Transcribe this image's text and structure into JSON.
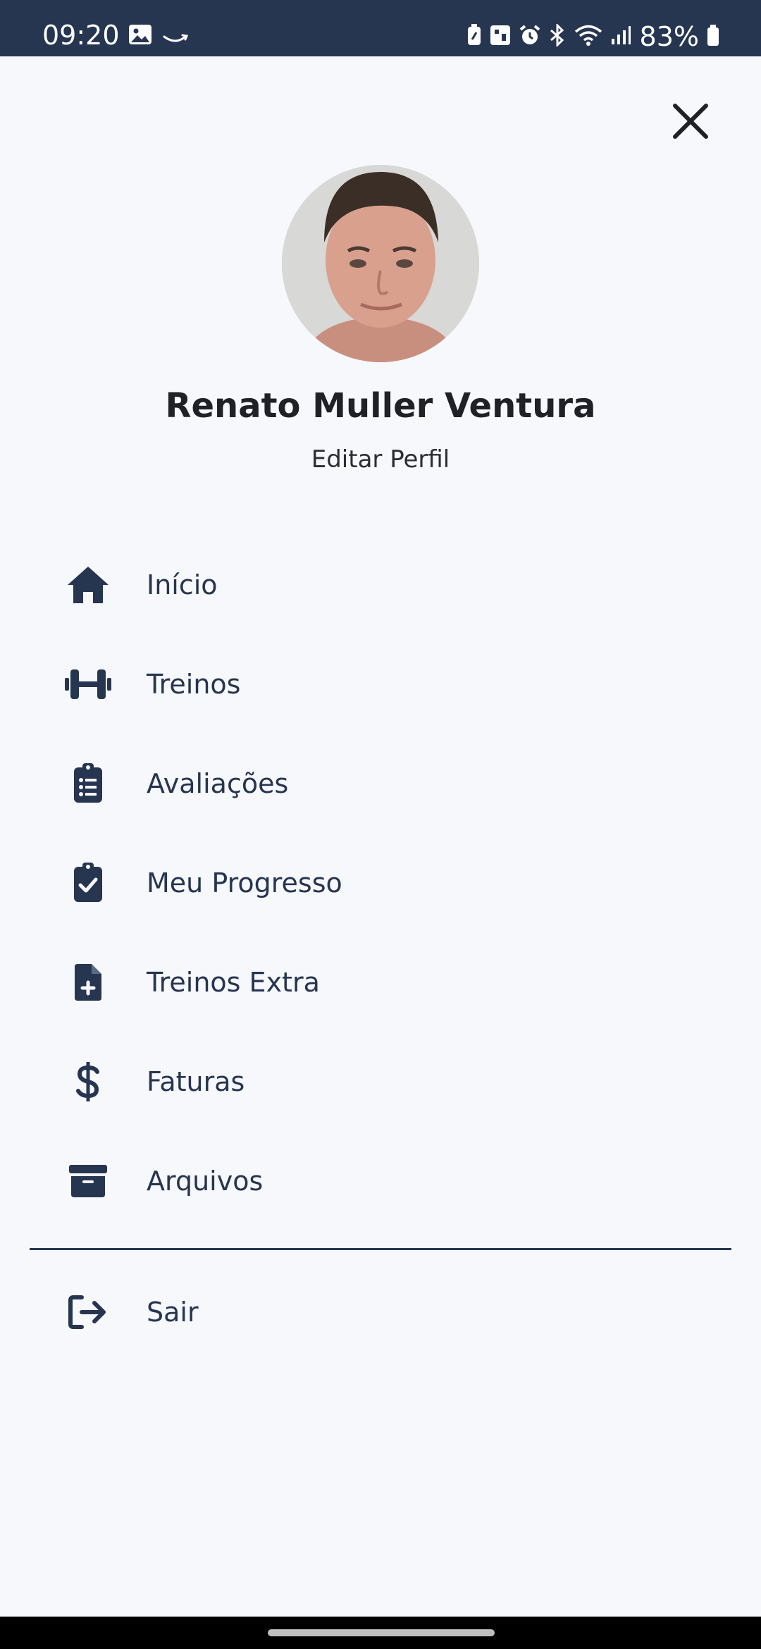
{
  "status_bar": {
    "time": "09:20",
    "battery": "83%",
    "icons": [
      "image-icon",
      "amazon-icon",
      "battery-saver-icon",
      "sim-icon",
      "alarm-icon",
      "bluetooth-icon",
      "wifi-icon",
      "signal-icon",
      "battery-icon"
    ]
  },
  "header": {
    "close_icon": "close-icon"
  },
  "profile": {
    "name": "Renato Muller Ventura",
    "edit_label": "Editar Perfil"
  },
  "menu": {
    "items": [
      {
        "label": "Início",
        "icon": "home-icon"
      },
      {
        "label": "Treinos",
        "icon": "dumbbell-icon"
      },
      {
        "label": "Avaliações",
        "icon": "clipboard-list-icon"
      },
      {
        "label": "Meu Progresso",
        "icon": "clipboard-check-icon"
      },
      {
        "label": "Treinos Extra",
        "icon": "file-plus-icon"
      },
      {
        "label": "Faturas",
        "icon": "dollar-icon"
      },
      {
        "label": "Arquivos",
        "icon": "archive-icon"
      }
    ],
    "logout_label": "Sair",
    "logout_icon": "logout-icon"
  },
  "colors": {
    "status_bar_bg": "#263550",
    "background": "#f7f8fc",
    "menu_text": "#263550",
    "name_text": "#1f2126"
  }
}
